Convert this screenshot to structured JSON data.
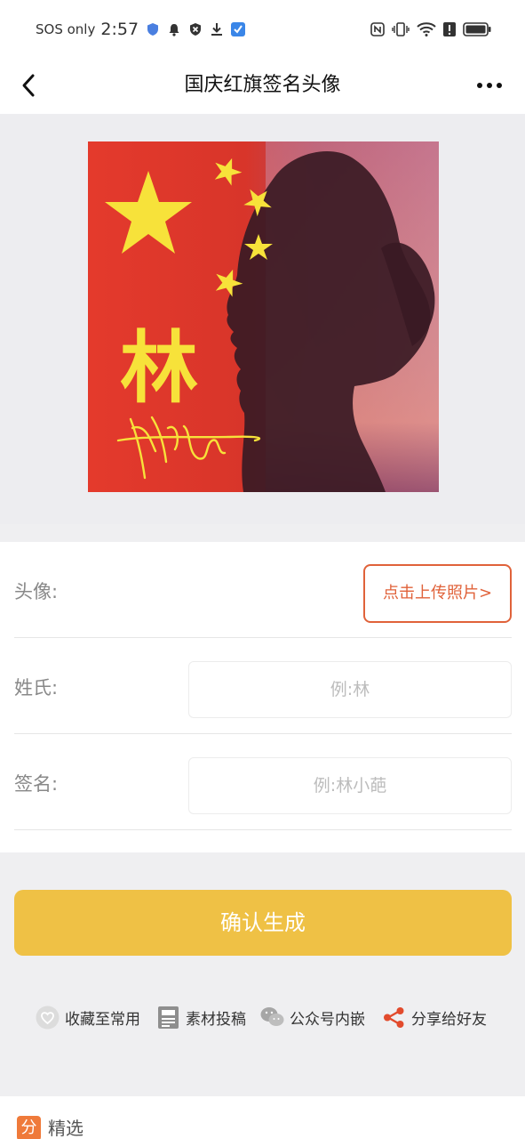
{
  "status_bar": {
    "sos_text": "SOS only",
    "time": "2:57"
  },
  "header": {
    "title": "国庆红旗签名头像"
  },
  "preview": {
    "surname_char": "林",
    "flag_color": "#e43a2c",
    "star_color": "#f7e23a"
  },
  "form": {
    "avatar_label": "头像:",
    "upload_button": "点击上传照片>",
    "surname_label": "姓氏:",
    "surname_placeholder": "例:林",
    "signature_label": "签名:",
    "signature_placeholder": "例:林小葩"
  },
  "confirm_button": "确认生成",
  "actions": [
    {
      "label": "收藏至常用",
      "icon": "heart-icon"
    },
    {
      "label": "素材投稿",
      "icon": "document-icon"
    },
    {
      "label": "公众号内嵌",
      "icon": "wechat-icon"
    },
    {
      "label": "分享给好友",
      "icon": "share-icon"
    }
  ],
  "featured": {
    "badge": "分",
    "label": "精选"
  },
  "colors": {
    "accent": "#efc145",
    "upload_border": "#e0623a",
    "share_red": "#e24b2d"
  }
}
